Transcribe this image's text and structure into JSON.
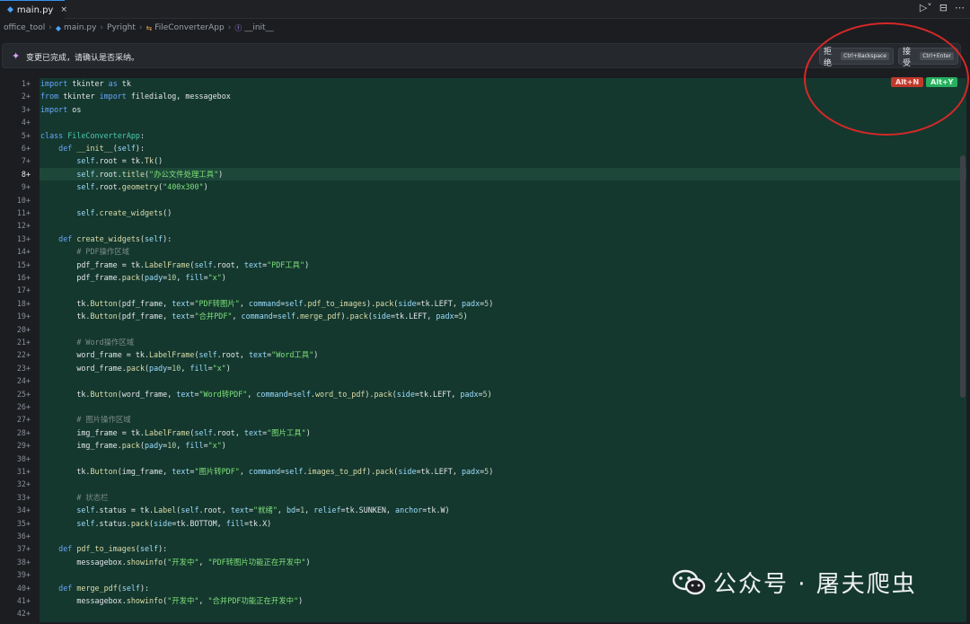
{
  "tab": {
    "label": "main.py",
    "close": "×"
  },
  "breadcrumb": [
    "office_tool",
    "main.py",
    "Pyright",
    "FileConverterApp",
    "__init__"
  ],
  "chat": {
    "message": "变更已完成，请确认是否采纳。",
    "reject_label": "拒绝",
    "reject_kbd": "Ctrl+Backspace",
    "accept_label": "接受",
    "accept_kbd": "Ctrl+Enter"
  },
  "badges": {
    "reject": "Alt+N",
    "accept": "Alt+Y"
  },
  "watermark": "公众号 · 屠夫爬虫",
  "active_line": 8,
  "line_numbers": [
    "1+",
    "2+",
    "3+",
    "4+",
    "5+",
    "6+",
    "7+",
    "8+",
    "9+",
    "10+",
    "11+",
    "12+",
    "13+",
    "14+",
    "15+",
    "16+",
    "17+",
    "18+",
    "19+",
    "20+",
    "21+",
    "22+",
    "23+",
    "24+",
    "25+",
    "26+",
    "27+",
    "28+",
    "29+",
    "30+",
    "31+",
    "32+",
    "33+",
    "34+",
    "35+",
    "36+",
    "37+",
    "38+",
    "39+",
    "40+",
    "41+",
    "42+"
  ],
  "code": [
    "import tkinter as tk",
    "from tkinter import filedialog, messagebox",
    "import os",
    "",
    "class FileConverterApp:",
    "    def __init__(self):",
    "        self.root = tk.Tk()",
    "        self.root.title(\"办公文件处理工具\")",
    "        self.root.geometry(\"400x300\")",
    "",
    "        self.create_widgets()",
    "",
    "    def create_widgets(self):",
    "        # PDF操作区域",
    "        pdf_frame = tk.LabelFrame(self.root, text=\"PDF工具\")",
    "        pdf_frame.pack(pady=10, fill=\"x\")",
    "",
    "        tk.Button(pdf_frame, text=\"PDF转图片\", command=self.pdf_to_images).pack(side=tk.LEFT, padx=5)",
    "        tk.Button(pdf_frame, text=\"合并PDF\", command=self.merge_pdf).pack(side=tk.LEFT, padx=5)",
    "",
    "        # Word操作区域",
    "        word_frame = tk.LabelFrame(self.root, text=\"Word工具\")",
    "        word_frame.pack(pady=10, fill=\"x\")",
    "",
    "        tk.Button(word_frame, text=\"Word转PDF\", command=self.word_to_pdf).pack(side=tk.LEFT, padx=5)",
    "",
    "        # 图片操作区域",
    "        img_frame = tk.LabelFrame(self.root, text=\"图片工具\")",
    "        img_frame.pack(pady=10, fill=\"x\")",
    "",
    "        tk.Button(img_frame, text=\"图片转PDF\", command=self.images_to_pdf).pack(side=tk.LEFT, padx=5)",
    "",
    "        # 状态栏",
    "        self.status = tk.Label(self.root, text=\"就绪\", bd=1, relief=tk.SUNKEN, anchor=tk.W)",
    "        self.status.pack(side=tk.BOTTOM, fill=tk.X)",
    "",
    "    def pdf_to_images(self):",
    "        messagebox.showinfo(\"开发中\", \"PDF转图片功能正在开发中\")",
    "",
    "    def merge_pdf(self):",
    "        messagebox.showinfo(\"开发中\", \"合并PDF功能正在开发中\")",
    ""
  ],
  "colors": {
    "accent": "#3b8ee6",
    "diff_added_bg": "#14382e",
    "reject_badge": "#c0392b",
    "accept_badge": "#27ae60",
    "annotation": "#d62828"
  }
}
